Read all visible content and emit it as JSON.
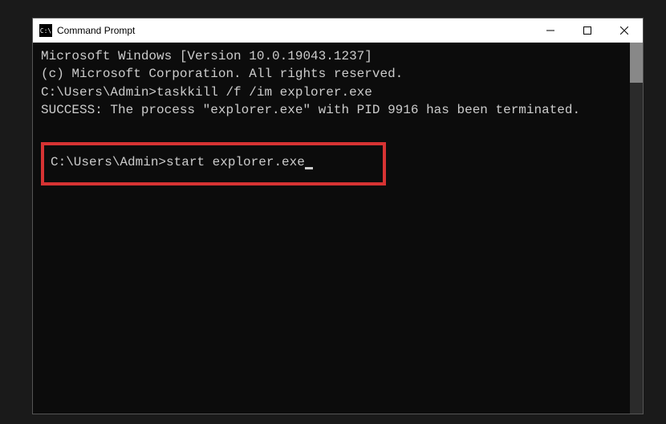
{
  "titlebar": {
    "icon_label": "C:\\",
    "title": "Command Prompt"
  },
  "terminal": {
    "line1": "Microsoft Windows [Version 10.0.19043.1237]",
    "line2": "(c) Microsoft Corporation. All rights reserved.",
    "blank1": "",
    "prompt1": "C:\\Users\\Admin>taskkill /f /im explorer.exe",
    "output1": "SUCCESS: The process \"explorer.exe\" with PID 9916 has been terminated.",
    "blank2": "",
    "prompt2_prefix": "C:\\Users\\Admin>",
    "prompt2_cmd": "start explorer.exe"
  },
  "highlight_color": "#d73333"
}
